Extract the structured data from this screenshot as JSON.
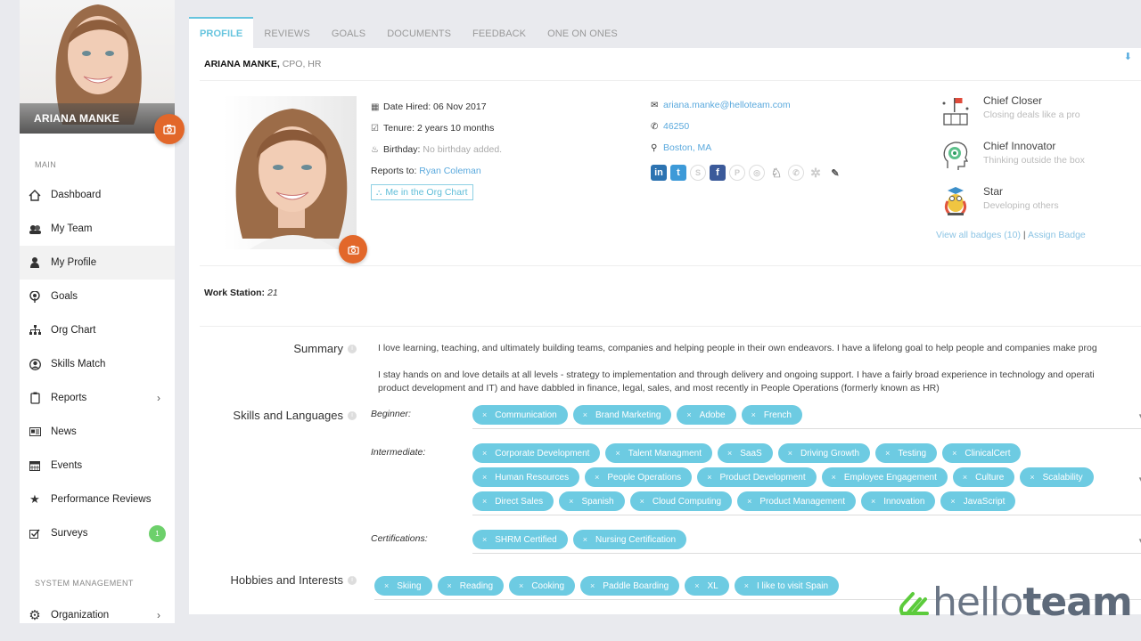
{
  "sidebar": {
    "user_name": "ARIANA MANKE",
    "section_main": "MAIN",
    "section_system": "SYSTEM MANAGEMENT",
    "items": [
      {
        "label": "Dashboard",
        "icon": "home-icon"
      },
      {
        "label": "My Team",
        "icon": "team-icon"
      },
      {
        "label": "My Profile",
        "icon": "user-icon",
        "active": true
      },
      {
        "label": "Goals",
        "icon": "goals-icon"
      },
      {
        "label": "Org Chart",
        "icon": "sitemap-icon"
      },
      {
        "label": "Skills Match",
        "icon": "user-circle-icon"
      },
      {
        "label": "Reports",
        "icon": "clipboard-icon",
        "has_submenu": true
      },
      {
        "label": "News",
        "icon": "newspaper-icon"
      },
      {
        "label": "Events",
        "icon": "calendar-icon"
      },
      {
        "label": "Performance Reviews",
        "icon": "star-icon"
      },
      {
        "label": "Surveys",
        "icon": "checkbox-icon",
        "badge": "1"
      }
    ],
    "system_items": [
      {
        "label": "Organization",
        "icon": "gear-icon",
        "has_submenu": true
      }
    ]
  },
  "tabs": [
    {
      "label": "PROFILE",
      "active": true
    },
    {
      "label": "REVIEWS"
    },
    {
      "label": "GOALS"
    },
    {
      "label": "DOCUMENTS"
    },
    {
      "label": "FEEDBACK"
    },
    {
      "label": "ONE ON ONES"
    }
  ],
  "profile": {
    "name": "ARIANA MANKE,",
    "role": "CPO, HR",
    "date_hired_label": "Date Hired:",
    "date_hired": "06 Nov 2017",
    "tenure_label": "Tenure:",
    "tenure": "2 years 10 months",
    "birthday_label": "Birthday:",
    "birthday": "No birthday added.",
    "reports_to_label": "Reports to:",
    "reports_to": "Ryan Coleman",
    "org_chart_button": "Me in the Org Chart",
    "email": "ariana.manke@helloteam.com",
    "phone": "46250",
    "location": "Boston, MA",
    "social": [
      {
        "name": "linkedin",
        "label": "in",
        "active": true
      },
      {
        "name": "twitter",
        "label": "t",
        "active": true
      },
      {
        "name": "skype",
        "label": "S",
        "active": false
      },
      {
        "name": "facebook",
        "label": "f",
        "active": true
      },
      {
        "name": "pinterest",
        "label": "P",
        "active": false
      },
      {
        "name": "instagram",
        "label": "◎",
        "active": false
      },
      {
        "name": "other",
        "label": "♘",
        "active": false
      },
      {
        "name": "whatsapp",
        "label": "✆",
        "active": false
      },
      {
        "name": "slack",
        "label": "✲",
        "active": false
      }
    ],
    "work_station_label": "Work Station:",
    "work_station": "21"
  },
  "badges": {
    "items": [
      {
        "title": "Chief Closer",
        "subtitle": "Closing deals like a pro"
      },
      {
        "title": "Chief Innovator",
        "subtitle": "Thinking outside the box"
      },
      {
        "title": "Star",
        "subtitle": "Developing others"
      }
    ],
    "view_all": "View all badges (10)",
    "separator": "|",
    "assign": "Assign Badge"
  },
  "summary": {
    "label": "Summary",
    "paragraphs": [
      "I love learning, teaching, and ultimately building teams, companies and helping people in their own endeavors. I have a lifelong goal to help people and companies make prog",
      "I stay hands on and love details at all levels - strategy to implementation and through delivery and ongoing support. I have a fairly broad experience in technology and operati",
      "product development and IT) and have dabbled in finance, legal, sales, and most recently in People Operations (formerly known as HR)"
    ]
  },
  "skills": {
    "label": "Skills and Languages",
    "beginner_label": "Beginner:",
    "beginner": [
      "Communication",
      "Brand Marketing",
      "Adobe",
      "French"
    ],
    "intermediate_label": "Intermediate:",
    "intermediate": [
      "Corporate Development",
      "Talent Managment",
      "SaaS",
      "Driving Growth",
      "Testing",
      "ClinicalCert",
      "Human Resources",
      "People Operations",
      "Product Development",
      "Employee Engagement",
      "Culture",
      "Scalability",
      "Direct Sales",
      "Spanish",
      "Cloud Computing",
      "Product Management",
      "Innovation",
      "JavaScript"
    ],
    "certifications_label": "Certifications:",
    "certifications": [
      "SHRM Certified",
      "Nursing Certification"
    ]
  },
  "hobbies": {
    "label": "Hobbies and Interests",
    "items": [
      "Skiing",
      "Reading",
      "Cooking",
      "Paddle Boarding",
      "XL",
      "I like to visit Spain"
    ]
  },
  "brand": {
    "light": "hello",
    "bold": "team",
    "green": "#5ccb3c",
    "accent": "#66c4de",
    "orange": "#e2672a"
  }
}
